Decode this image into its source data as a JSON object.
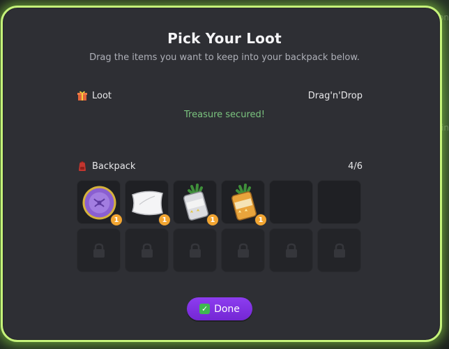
{
  "modal": {
    "title": "Pick Your Loot",
    "subtitle": "Drag the items you want to keep into your backpack below."
  },
  "loot": {
    "label": "Loot",
    "mode": "Drag'n'Drop",
    "status": "Treasure secured!",
    "icon": "gift-icon"
  },
  "backpack": {
    "label": "Backpack",
    "count": "4/6",
    "icon": "backpack-icon",
    "slots": [
      {
        "item": "purple-cushion",
        "qty": "1"
      },
      {
        "item": "white-pillow",
        "qty": "1"
      },
      {
        "item": "spinach-can-silver",
        "qty": "1"
      },
      {
        "item": "spinach-can-gold",
        "qty": "1"
      },
      {
        "item": null
      },
      {
        "item": null
      }
    ],
    "locked_slots": 6
  },
  "done_button": {
    "label": "Done",
    "icon": "check-icon"
  },
  "background": {
    "side_texts": [
      "on",
      "in"
    ]
  },
  "colors": {
    "modal_border": "#c5f27a",
    "status_green": "#7bc47f",
    "badge": "#f2a531",
    "button": "#7f33e0"
  }
}
